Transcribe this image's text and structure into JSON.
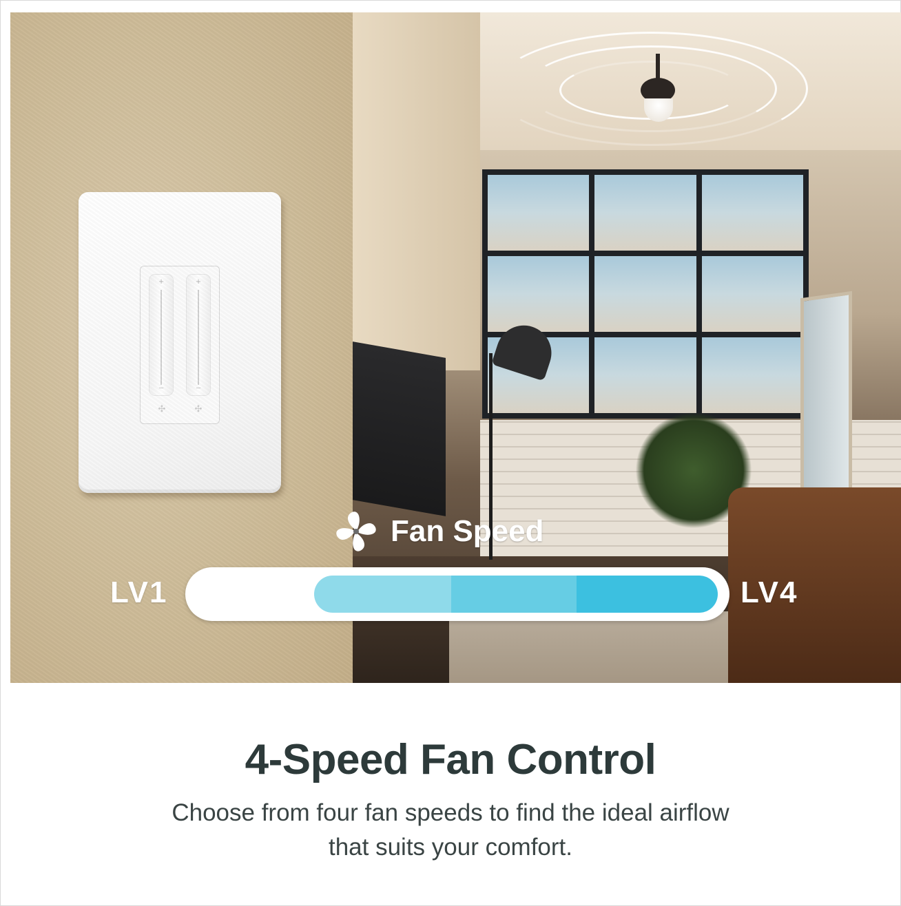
{
  "fan_speed": {
    "label": "Fan Speed",
    "min_label": "LV1",
    "max_label": "LV4",
    "levels": 4,
    "segment_colors": [
      "#b5e7ee",
      "#8fdaea",
      "#66cde4",
      "#3cc0e0"
    ]
  },
  "heading": "4-Speed Fan Control",
  "description": {
    "line1": "Choose from four fan speeds to find the ideal airflow",
    "line2": "that suits your comfort."
  },
  "colors": {
    "accent": "#3cc0e0",
    "heading": "#2d3a3a"
  }
}
